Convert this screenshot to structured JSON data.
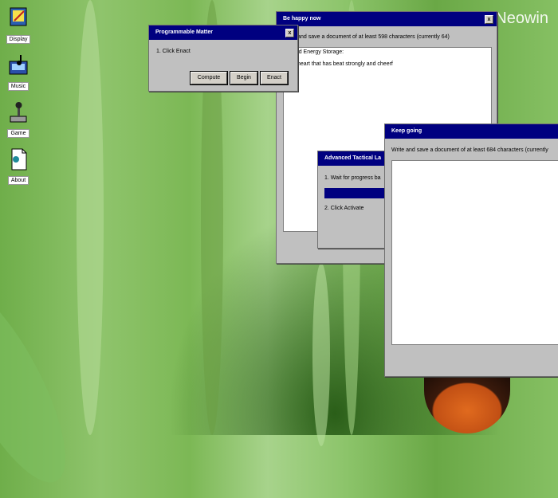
{
  "watermark": "Neowin",
  "desktop_icons": [
    {
      "label": "Display"
    },
    {
      "label": "Music"
    },
    {
      "label": "Game"
    },
    {
      "label": "About"
    }
  ],
  "windows": {
    "programmable_matter": {
      "title": "Programmable Matter",
      "step": "1. Click Enact",
      "buttons": [
        "Compute",
        "Begin",
        "Enact"
      ]
    },
    "be_happy": {
      "title": "Be happy now",
      "instruction": "Write and save a document of at least 598 characters (currently 64)",
      "doc_line1": "Tuned Energy Storage:",
      "doc_line2": "The heart that has beat strongly and cheerf"
    },
    "advanced_tactical": {
      "title": "Advanced Tactical La",
      "step1": "1. Wait for progress ba",
      "step2": "2. Click Activate",
      "progress": 1
    },
    "keep_going": {
      "title": "Keep going",
      "instruction": "Write and save a document of at least 684 characters (currently"
    }
  },
  "close_glyph": "x"
}
